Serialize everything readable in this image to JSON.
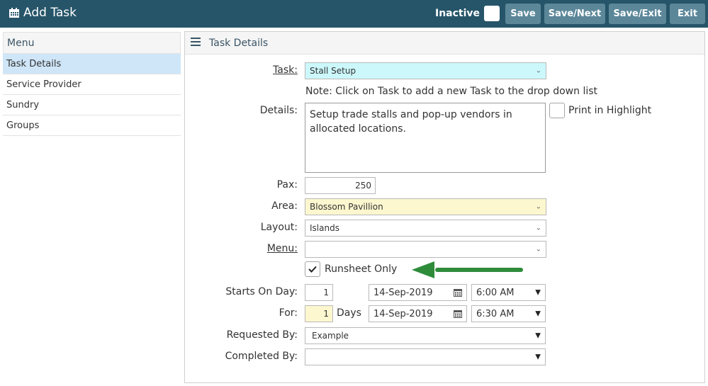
{
  "header": {
    "title": "Add Task",
    "icon": "calendar-icon",
    "inactive_label": "Inactive",
    "buttons": {
      "save": "Save",
      "save_next": "Save/Next",
      "save_exit": "Save/Exit",
      "exit": "Exit"
    }
  },
  "sidebar": {
    "heading": "Menu",
    "items": [
      {
        "label": "Task Details"
      },
      {
        "label": "Service Provider"
      },
      {
        "label": "Sundry"
      },
      {
        "label": "Groups"
      }
    ]
  },
  "main": {
    "heading": "Task Details",
    "task": {
      "label": "Task:",
      "value": "Stall Setup"
    },
    "note": "Note: Click on Task to add a new Task to the drop down list",
    "details": {
      "label": "Details:",
      "value": "Setup trade stalls and pop-up vendors in allocated locations."
    },
    "print_highlight": {
      "label": "Print in Highlight",
      "checked": false
    },
    "pax": {
      "label": "Pax:",
      "value": "250"
    },
    "area": {
      "label": "Area:",
      "value": "Blossom Pavillion"
    },
    "layout": {
      "label": "Layout:",
      "value": "Islands"
    },
    "menu": {
      "label": "Menu:",
      "value": ""
    },
    "runsheet": {
      "label": "Runsheet Only",
      "checked": true
    },
    "starts_on_day": {
      "label": "Starts On Day:",
      "day": "1",
      "date": "14-Sep-2019",
      "time": "6:00 AM"
    },
    "for": {
      "label": "For:",
      "value": "1",
      "unit": "Days",
      "date": "14-Sep-2019",
      "time": "6:30 AM"
    },
    "requested_by": {
      "label": "Requested By:",
      "value": "Example"
    },
    "completed_by": {
      "label": "Completed By:",
      "value": ""
    }
  },
  "colors": {
    "topbar": "#265569",
    "button": "#5b8799",
    "active_menu": "#cfe6f8",
    "task_field": "#ccf8fb",
    "area_field": "#fdf7cf",
    "arrow": "#2e8b3a"
  }
}
